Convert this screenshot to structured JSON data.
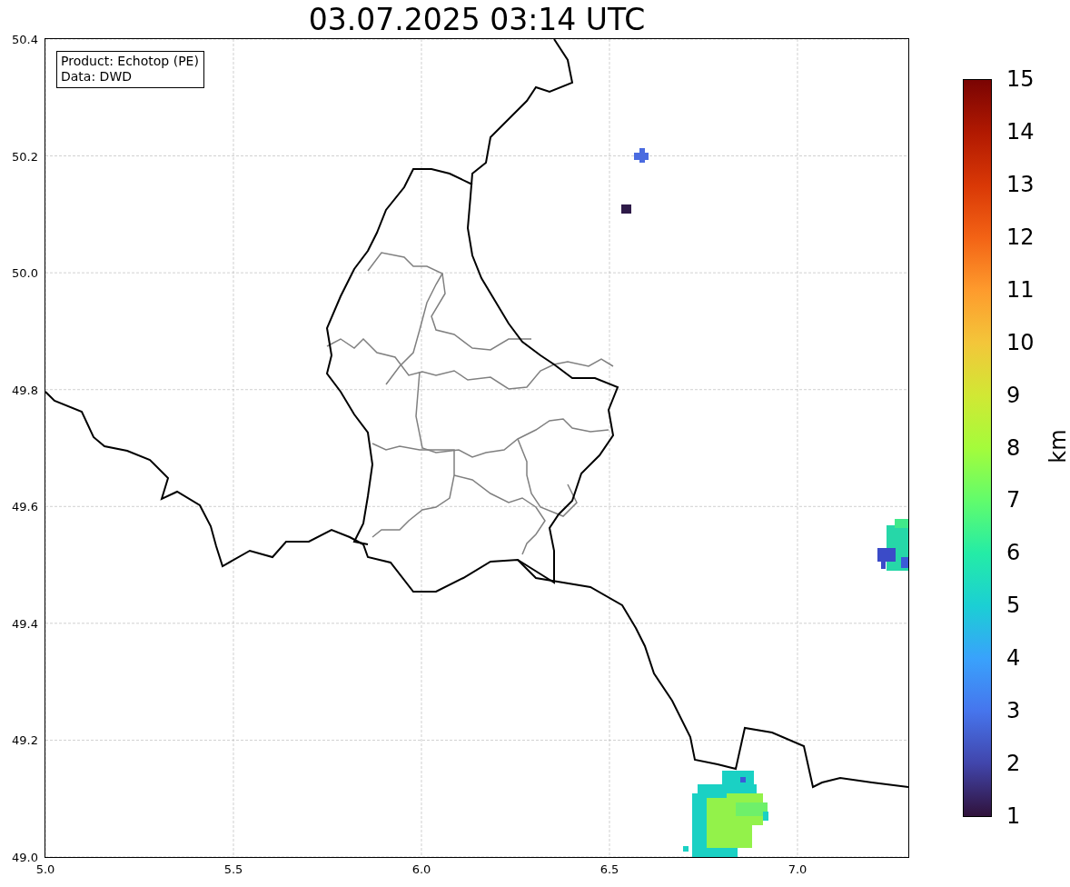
{
  "title": "03.07.2025 03:14 UTC",
  "map": {
    "legend": [
      "Product: Echotop (PE)",
      "Data: DWD"
    ],
    "xticks": [
      "5.0",
      "5.5",
      "6.0",
      "6.5",
      "7.0"
    ],
    "yticks": [
      "50.4",
      "50.2",
      "50.0",
      "49.8",
      "49.6",
      "49.4",
      "49.2",
      "49.0"
    ]
  },
  "colorbar": {
    "label": "km",
    "ticks": [
      "15",
      "14",
      "13",
      "12",
      "11",
      "10",
      "9",
      "8",
      "7",
      "6",
      "5",
      "4",
      "3",
      "2",
      "1"
    ]
  }
}
